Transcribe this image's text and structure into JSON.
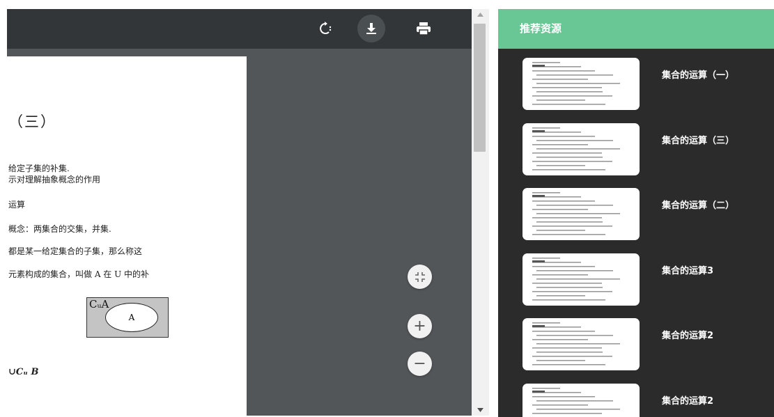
{
  "toolbar": {
    "rotate_icon": "rotate-icon",
    "download_icon": "download-icon",
    "print_icon": "print-icon"
  },
  "document": {
    "title": "（三）",
    "lines": [
      "给定子集的补集.",
      "示对理解抽象概念的作用",
      "运算",
      "概念：两集合的交集，并集.",
      "都是某一给定集合的子集，那么称这",
      "元素构成的集合，叫做 A 在 U 中的补"
    ],
    "venn": {
      "complement_label": "CᵤA",
      "set_label": "A"
    },
    "formula": "∪Cᵤ B"
  },
  "zoom_controls": {
    "fit_icon": "fit-to-page-icon",
    "zoom_in_label": "+",
    "zoom_out_label": "−"
  },
  "sidebar": {
    "header": "推荐资源",
    "items": [
      {
        "title": "集合的运算（一）"
      },
      {
        "title": "集合的运算（三）"
      },
      {
        "title": "集合的运算（二）"
      },
      {
        "title": "集合的运算3"
      },
      {
        "title": "集合的运算2"
      },
      {
        "title": "集合的运算2"
      }
    ]
  },
  "colors": {
    "viewer_bg": "#525659",
    "toolbar_bg": "#323639",
    "sidebar_header": "#68c794",
    "sidebar_bg": "#2b2b2b"
  }
}
